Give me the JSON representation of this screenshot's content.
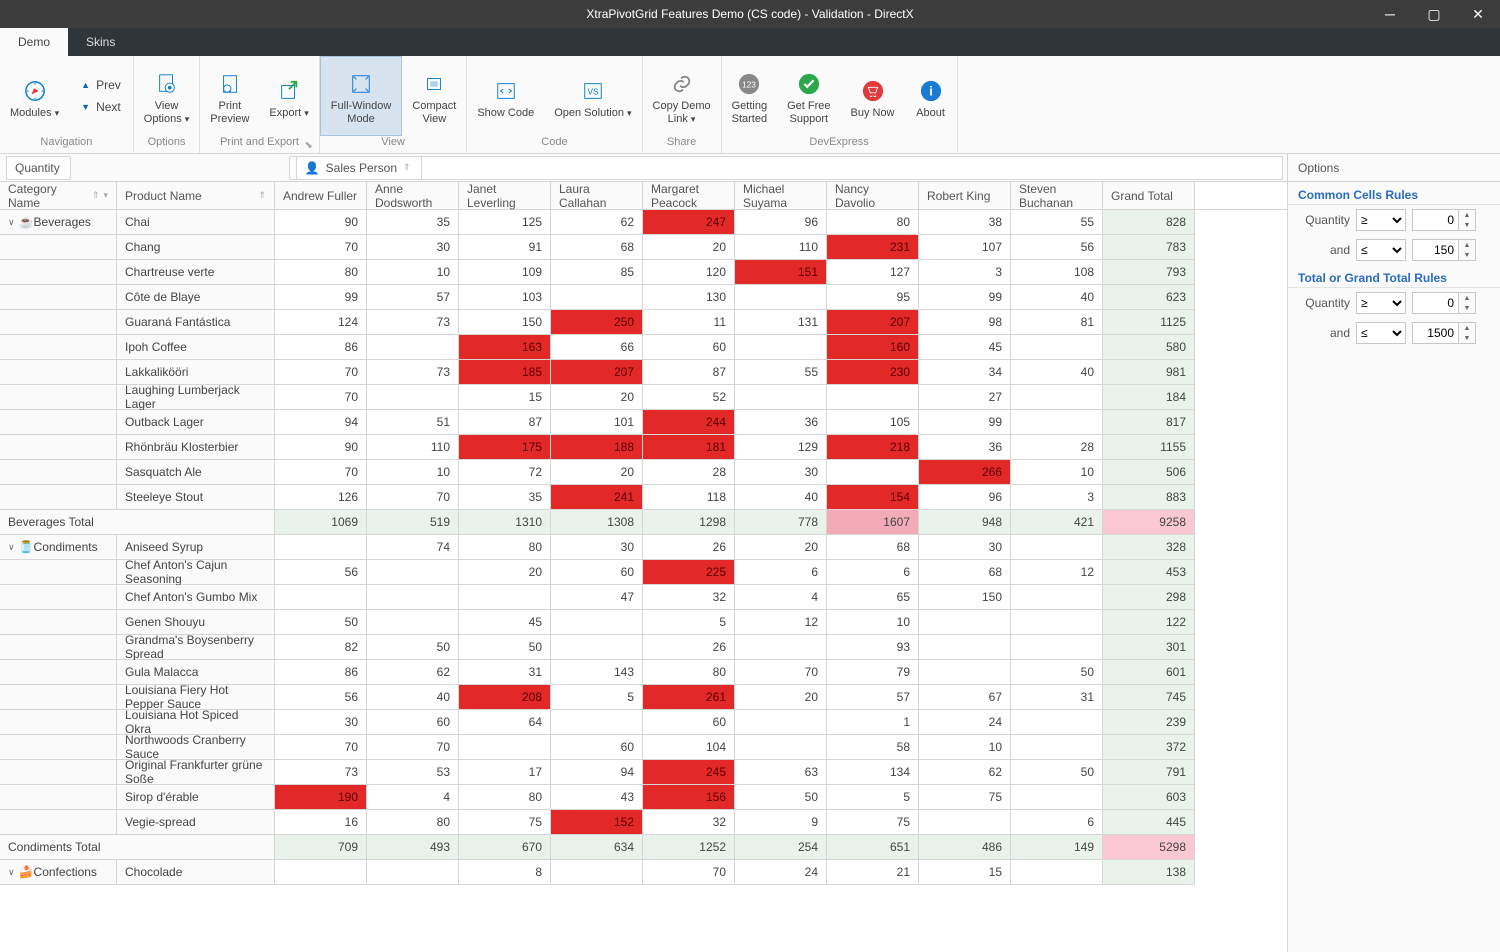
{
  "window": {
    "title": "XtraPivotGrid Features Demo (CS code) - Validation - DirectX"
  },
  "tabs": [
    {
      "label": "Demo",
      "active": true
    },
    {
      "label": "Skins",
      "active": false
    }
  ],
  "ribbon": {
    "groups": [
      {
        "caption": "Navigation",
        "items": [
          {
            "type": "big",
            "label": "Modules",
            "dropdown": true,
            "icon": "compass"
          },
          {
            "type": "split",
            "top": "Prev",
            "bottom": "Next"
          }
        ]
      },
      {
        "caption": "Options",
        "items": [
          {
            "type": "big",
            "label": "View\nOptions",
            "dropdown": true,
            "icon": "gearpage"
          }
        ]
      },
      {
        "caption": "Print and Export",
        "items": [
          {
            "type": "big",
            "label": "Print\nPreview",
            "icon": "printprev"
          },
          {
            "type": "big",
            "label": "Export",
            "dropdown": true,
            "icon": "export"
          }
        ],
        "launcher": true
      },
      {
        "caption": "View",
        "items": [
          {
            "type": "big",
            "label": "Full-Window\nMode",
            "icon": "fullscreen",
            "selected": true
          },
          {
            "type": "big",
            "label": "Compact\nView",
            "icon": "compact"
          }
        ]
      },
      {
        "caption": "Code",
        "items": [
          {
            "type": "big",
            "label": "Show Code",
            "icon": "code"
          },
          {
            "type": "big",
            "label": "Open Solution",
            "dropdown": true,
            "icon": "solution"
          }
        ]
      },
      {
        "caption": "Share",
        "items": [
          {
            "type": "big",
            "label": "Copy Demo\nLink",
            "dropdown": true,
            "icon": "link"
          }
        ]
      },
      {
        "caption": "DevExpress",
        "items": [
          {
            "type": "big",
            "label": "Getting\nStarted",
            "icon": "g123",
            "color": "#888"
          },
          {
            "type": "big",
            "label": "Get Free\nSupport",
            "icon": "check",
            "color": "#2aa84a"
          },
          {
            "type": "big",
            "label": "Buy Now",
            "icon": "cart",
            "color": "#e03a3a"
          },
          {
            "type": "big",
            "label": "About",
            "icon": "info",
            "color": "#1a7ad4"
          }
        ]
      }
    ]
  },
  "grid": {
    "data_field": "Quantity",
    "column_field": "Sales Person",
    "row_fields": [
      "Category Name",
      "Product Name"
    ],
    "columns": [
      "Andrew Fuller",
      "Anne Dodsworth",
      "Janet Leverling",
      "Laura Callahan",
      "Margaret Peacock",
      "Michael Suyama",
      "Nancy Davolio",
      "Robert King",
      "Steven Buchanan",
      "Grand Total"
    ],
    "categories": [
      {
        "name": "Beverages",
        "icon": "cup",
        "expanded": true,
        "products": [
          {
            "name": "Chai",
            "v": [
              90,
              35,
              125,
              62,
              247,
              96,
              80,
              38,
              55,
              828
            ],
            "red": [
              4
            ]
          },
          {
            "name": "Chang",
            "v": [
              70,
              30,
              91,
              68,
              20,
              110,
              231,
              107,
              56,
              783
            ],
            "red": [
              6
            ]
          },
          {
            "name": "Chartreuse verte",
            "v": [
              80,
              10,
              109,
              85,
              120,
              151,
              127,
              3,
              108,
              793
            ],
            "red": [
              5
            ]
          },
          {
            "name": "Côte de Blaye",
            "v": [
              99,
              57,
              103,
              null,
              130,
              null,
              95,
              99,
              40,
              623
            ],
            "red": []
          },
          {
            "name": "Guaraná Fantástica",
            "v": [
              124,
              73,
              150,
              250,
              11,
              131,
              207,
              98,
              81,
              1125
            ],
            "red": [
              3,
              6
            ]
          },
          {
            "name": "Ipoh Coffee",
            "v": [
              86,
              null,
              163,
              66,
              60,
              null,
              160,
              45,
              null,
              580
            ],
            "red": [
              2,
              6
            ]
          },
          {
            "name": "Lakkalikööri",
            "v": [
              70,
              73,
              185,
              207,
              87,
              55,
              230,
              34,
              40,
              981
            ],
            "red": [
              2,
              3,
              6
            ]
          },
          {
            "name": "Laughing Lumberjack Lager",
            "v": [
              70,
              null,
              15,
              20,
              52,
              null,
              null,
              27,
              null,
              184
            ],
            "red": []
          },
          {
            "name": "Outback Lager",
            "v": [
              94,
              51,
              87,
              101,
              244,
              36,
              105,
              99,
              null,
              817
            ],
            "red": [
              4
            ]
          },
          {
            "name": "Rhönbräu Klosterbier",
            "v": [
              90,
              110,
              175,
              188,
              181,
              129,
              218,
              36,
              28,
              1155
            ],
            "red": [
              2,
              3,
              4,
              6
            ]
          },
          {
            "name": "Sasquatch Ale",
            "v": [
              70,
              10,
              72,
              20,
              28,
              30,
              null,
              266,
              10,
              506
            ],
            "red": [
              7
            ]
          },
          {
            "name": "Steeleye Stout",
            "v": [
              126,
              70,
              35,
              241,
              118,
              40,
              154,
              96,
              3,
              883
            ],
            "red": [
              3,
              6
            ]
          }
        ],
        "total_label": "Beverages Total",
        "total": [
          1069,
          519,
          1310,
          1308,
          1298,
          778,
          1607,
          948,
          421,
          9258
        ],
        "total_red": [
          6
        ],
        "total_pink": true
      },
      {
        "name": "Condiments",
        "icon": "bottle",
        "expanded": true,
        "products": [
          {
            "name": "Aniseed Syrup",
            "v": [
              null,
              74,
              80,
              30,
              26,
              20,
              68,
              30,
              null,
              328
            ],
            "red": []
          },
          {
            "name": "Chef Anton's Cajun Seasoning",
            "v": [
              56,
              null,
              20,
              60,
              225,
              6,
              6,
              68,
              12,
              453
            ],
            "red": [
              4
            ]
          },
          {
            "name": "Chef Anton's Gumbo Mix",
            "v": [
              null,
              null,
              null,
              47,
              32,
              4,
              65,
              150,
              null,
              298
            ],
            "red": []
          },
          {
            "name": "Genen Shouyu",
            "v": [
              50,
              null,
              45,
              null,
              5,
              12,
              10,
              null,
              null,
              122
            ],
            "red": []
          },
          {
            "name": "Grandma's Boysenberry Spread",
            "v": [
              82,
              50,
              50,
              null,
              26,
              null,
              93,
              null,
              null,
              301
            ],
            "red": []
          },
          {
            "name": "Gula Malacca",
            "v": [
              86,
              62,
              31,
              143,
              80,
              70,
              79,
              null,
              50,
              601
            ],
            "red": []
          },
          {
            "name": "Louisiana Fiery Hot Pepper Sauce",
            "v": [
              56,
              40,
              208,
              5,
              261,
              20,
              57,
              67,
              31,
              745
            ],
            "red": [
              2,
              4
            ]
          },
          {
            "name": "Louisiana Hot Spiced Okra",
            "v": [
              30,
              60,
              64,
              null,
              60,
              null,
              1,
              24,
              null,
              239
            ],
            "red": []
          },
          {
            "name": "Northwoods Cranberry Sauce",
            "v": [
              70,
              70,
              null,
              60,
              104,
              null,
              58,
              10,
              null,
              372
            ],
            "red": []
          },
          {
            "name": "Original Frankfurter grüne Soße",
            "v": [
              73,
              53,
              17,
              94,
              245,
              63,
              134,
              62,
              50,
              791
            ],
            "red": [
              4
            ]
          },
          {
            "name": "Sirop d'érable",
            "v": [
              190,
              4,
              80,
              43,
              156,
              50,
              5,
              75,
              null,
              603
            ],
            "red": [
              0,
              4
            ]
          },
          {
            "name": "Vegie-spread",
            "v": [
              16,
              80,
              75,
              152,
              32,
              9,
              75,
              null,
              6,
              445
            ],
            "red": [
              3
            ]
          }
        ],
        "total_label": "Condiments Total",
        "total": [
          709,
          493,
          670,
          634,
          1252,
          254,
          651,
          486,
          149,
          5298
        ],
        "total_red": [],
        "total_pink": true
      },
      {
        "name": "Confections",
        "icon": "cake",
        "expanded": true,
        "products": [
          {
            "name": "Chocolade",
            "v": [
              null,
              null,
              8,
              null,
              70,
              24,
              21,
              15,
              null,
              138
            ],
            "red": []
          }
        ]
      }
    ]
  },
  "options": {
    "title": "Options",
    "sections": [
      {
        "title": "Common Cells Rules",
        "rules": [
          {
            "label": "Quantity",
            "op": "≥",
            "value": 0
          },
          {
            "label": "and",
            "op": "≤",
            "value": 150
          }
        ]
      },
      {
        "title": "Total or Grand Total Rules",
        "rules": [
          {
            "label": "Quantity",
            "op": "≥",
            "value": 0
          },
          {
            "label": "and",
            "op": "≤",
            "value": 1500
          }
        ]
      }
    ]
  }
}
